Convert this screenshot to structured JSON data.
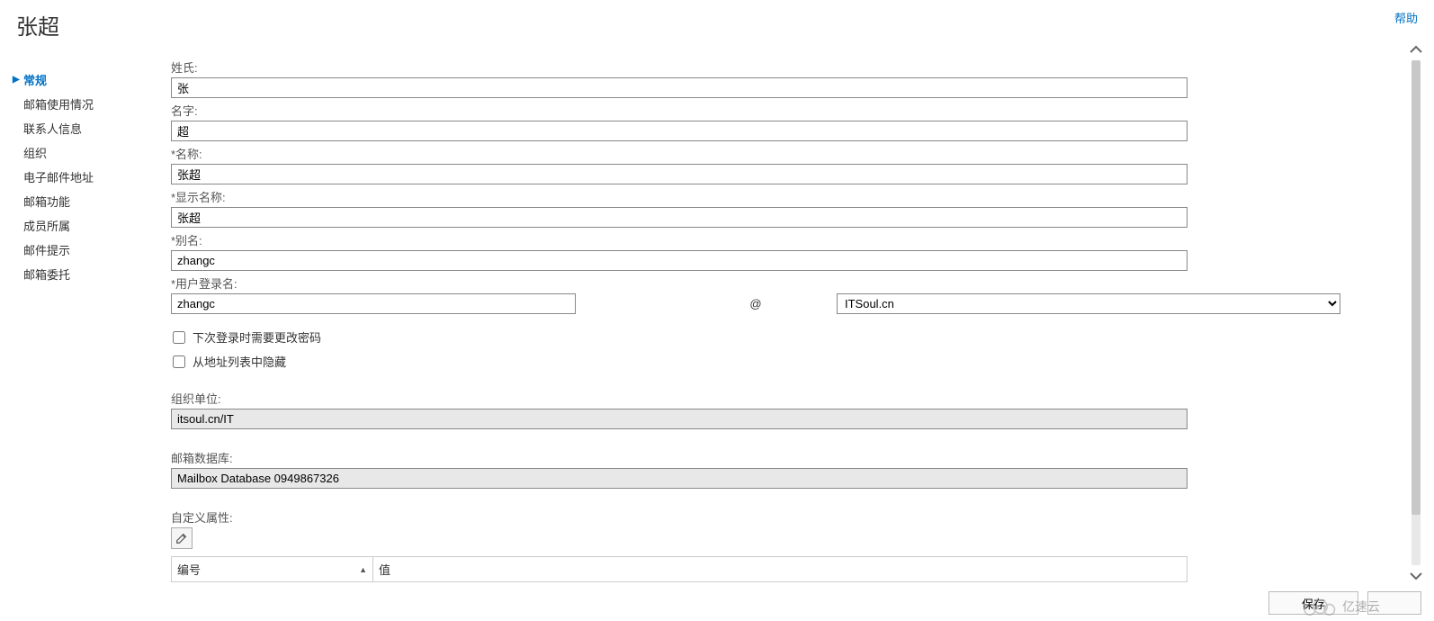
{
  "header": {
    "title": "张超",
    "help": "帮助"
  },
  "sidebar": {
    "items": [
      {
        "label": "常规",
        "active": true
      },
      {
        "label": "邮箱使用情况",
        "active": false
      },
      {
        "label": "联系人信息",
        "active": false
      },
      {
        "label": "组织",
        "active": false
      },
      {
        "label": "电子邮件地址",
        "active": false
      },
      {
        "label": "邮箱功能",
        "active": false
      },
      {
        "label": "成员所属",
        "active": false
      },
      {
        "label": "邮件提示",
        "active": false
      },
      {
        "label": "邮箱委托",
        "active": false
      }
    ]
  },
  "form": {
    "last_name_label": "姓氏:",
    "last_name_value": "张",
    "first_name_label": "名字:",
    "first_name_value": "超",
    "name_label": "*名称:",
    "name_value": "张超",
    "display_name_label": "*显示名称:",
    "display_name_value": "张超",
    "alias_label": "*别名:",
    "alias_value": "zhangc",
    "login_label": "*用户登录名:",
    "login_user_value": "zhangc",
    "at_symbol": "@",
    "login_domain_value": "ITSoul.cn",
    "chk_change_pwd_label": "下次登录时需要更改密码",
    "chk_hide_from_list_label": "从地址列表中隐藏",
    "ou_label": "组织单位:",
    "ou_value": "itsoul.cn/IT",
    "db_label": "邮箱数据库:",
    "db_value": "Mailbox Database 0949867326",
    "custom_attr_label": "自定义属性:",
    "table": {
      "col_number": "编号",
      "col_value": "值"
    }
  },
  "footer": {
    "save": "保存",
    "cancel": ""
  },
  "watermark": "亿速云"
}
